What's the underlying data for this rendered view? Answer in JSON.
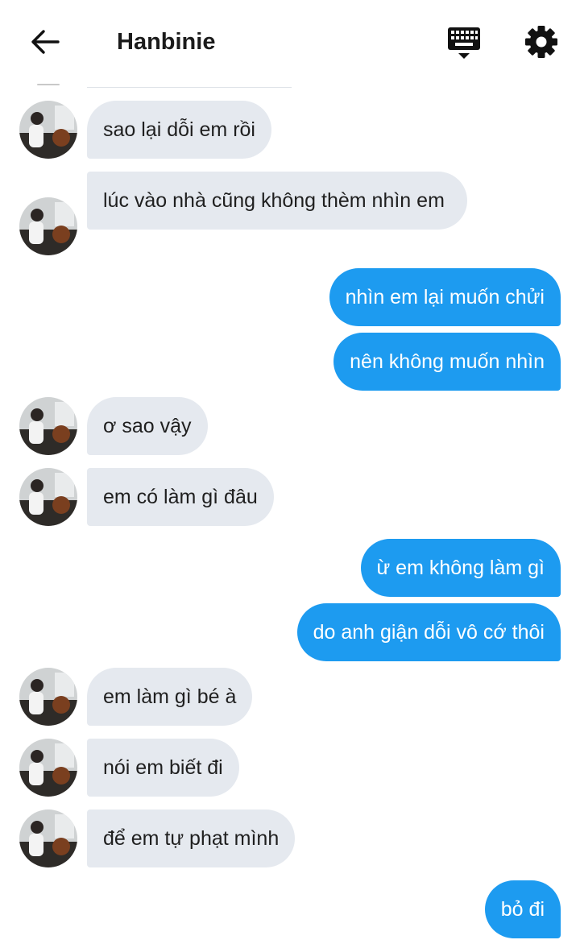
{
  "header": {
    "title": "Hanbinie",
    "back_icon": "arrow-left-icon",
    "keyboard_icon": "keyboard-icon",
    "settings_icon": "gear-icon"
  },
  "colors": {
    "incoming_bubble": "#e5e9ef",
    "outgoing_bubble": "#1d9bf0"
  },
  "messages": [
    {
      "from": "them",
      "text": "sao lại dỗi em rồi"
    },
    {
      "from": "them",
      "text": "lúc vào nhà cũng không thèm nhìn em"
    },
    {
      "from": "me",
      "text": "nhìn em lại muốn chửi"
    },
    {
      "from": "me",
      "text": "nên không muốn nhìn"
    },
    {
      "from": "them",
      "text": "ơ sao vậy"
    },
    {
      "from": "them",
      "text": "em có làm gì đâu"
    },
    {
      "from": "me",
      "text": "ừ em không làm gì"
    },
    {
      "from": "me",
      "text": "do anh giận dỗi vô cớ thôi"
    },
    {
      "from": "them",
      "text": "em làm gì bé à"
    },
    {
      "from": "them",
      "text": "nói em biết đi"
    },
    {
      "from": "them",
      "text": "để em tự phạt mình"
    },
    {
      "from": "me",
      "text": "bỏ đi"
    }
  ]
}
